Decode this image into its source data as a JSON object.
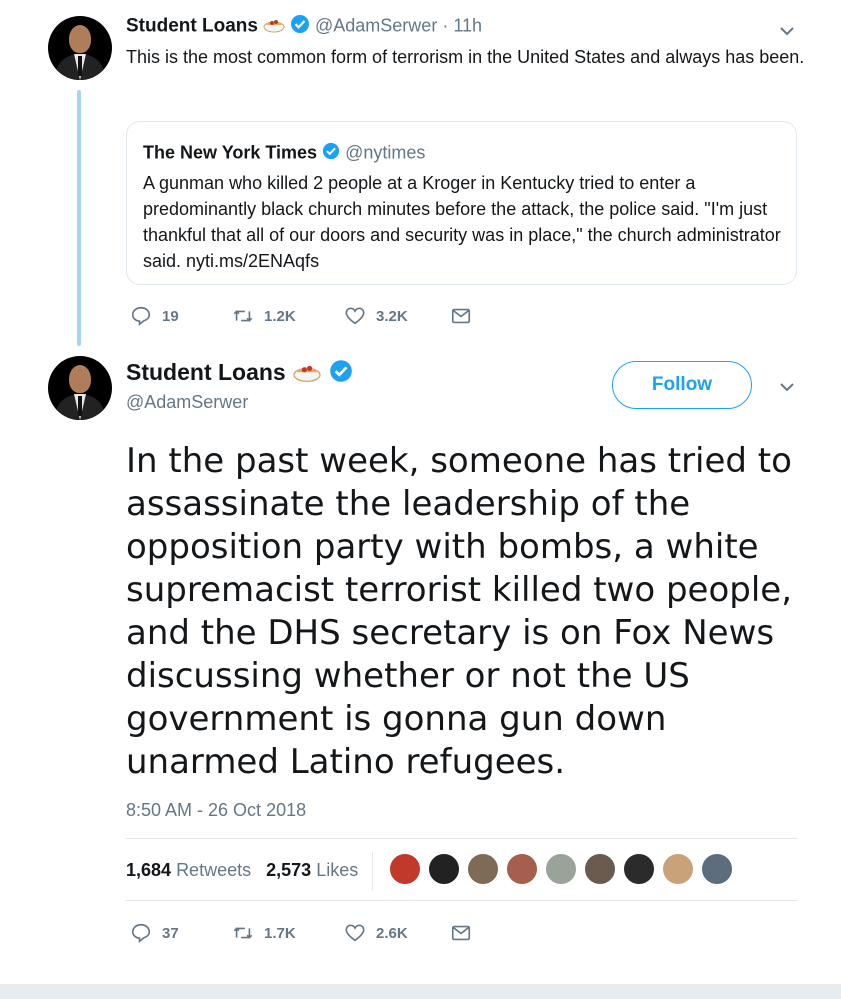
{
  "tweet1": {
    "name": "Student Loans",
    "handle": "@AdamSerwer",
    "time": "· 11h",
    "text": "This is the most common form of terrorism in the United States and always has been.",
    "quote": {
      "name": "The New York Times",
      "handle": "@nytimes",
      "text": "A gunman who killed 2 people at a Kroger in Kentucky tried to enter a predominantly black church minutes before the attack, the police said. \"I'm just thankful that all of our doors and security was in place,\" the church administrator said. nyti.ms/2ENAqfs"
    },
    "actions": {
      "replies": "19",
      "retweets": "1.2K",
      "likes": "3.2K"
    }
  },
  "tweet2": {
    "name": "Student Loans",
    "handle": "@AdamSerwer",
    "follow_label": "Follow",
    "text": "In the past week, someone has tried to assassinate the leadership of the opposition party with bombs, a white supremacist terrorist killed two people, and the DHS secretary is on Fox News discussing whether or not the US government is gonna gun down unarmed Latino refugees.",
    "timestamp": "8:50 AM - 26 Oct 2018",
    "stats": {
      "retweets_count": "1,684",
      "retweets_label": "Retweets",
      "likes_count": "2,573",
      "likes_label": "Likes"
    },
    "likers": [
      "#c0392b",
      "#222222",
      "#7f6a55",
      "#a65e4e",
      "#9aa39a",
      "#6b5a4e",
      "#2b2b2b",
      "#c9a27a",
      "#5d6d7e"
    ],
    "actions": {
      "replies": "37",
      "retweets": "1.7K",
      "likes": "2.6K"
    }
  },
  "icons": {
    "verified": "verified-badge-icon",
    "emoji": "spaghetti-emoji-icon",
    "reply": "reply-icon",
    "retweet": "retweet-icon",
    "like": "heart-icon",
    "dm": "envelope-icon",
    "more": "chevron-down-icon"
  },
  "colors": {
    "accent": "#1da1f2",
    "muted": "#657786",
    "thread": "#a6d4f2",
    "border": "#e1e8ed"
  }
}
